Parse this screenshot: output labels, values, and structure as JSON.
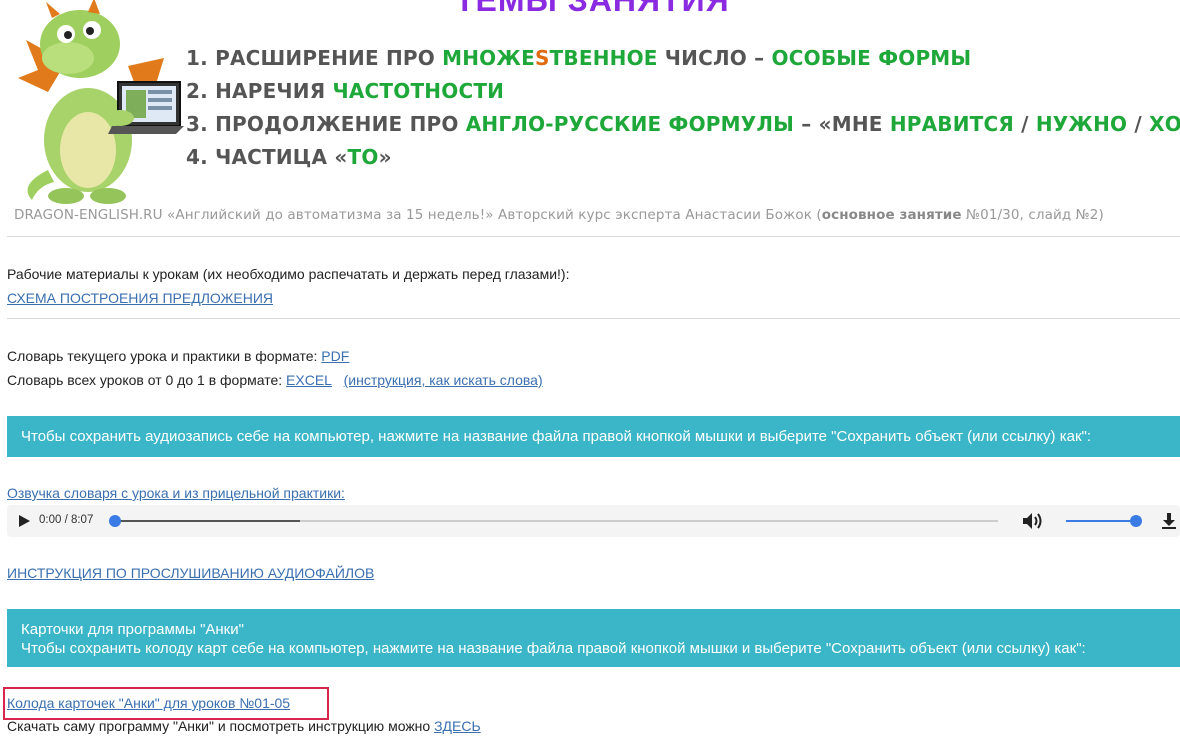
{
  "banner": {
    "title": "ТЕМЫ ЗАНЯТИЯ",
    "topics": [
      {
        "num": "1.",
        "a": "РАСШИРЕНИЕ ПРО ",
        "b": "МНОЖЕ",
        "c": "S",
        "d": "ТВЕННОЕ",
        "e": " ЧИСЛО – ",
        "f": "ОСОБЫЕ ФОРМЫ"
      },
      {
        "num": "2.",
        "a": "НАРЕЧИЯ ",
        "b": "ЧАСТОТНОСТИ"
      },
      {
        "num": "3.",
        "a": "ПРОДОЛЖЕНИЕ ПРО ",
        "b": "АНГЛО-РУССКИЕ ФОРМУЛЫ",
        "c": " – «МНЕ ",
        "d": "НРАВИТСЯ",
        "e": " / ",
        "f": "НУЖНО",
        "g": " / ",
        "h": "ХОЧЕТСЯ",
        "i": "»"
      },
      {
        "num": "4.",
        "a": "ЧАСТИЦА «",
        "b": "ТО",
        "c": "»"
      }
    ],
    "footer": {
      "prefix": "DRAGON-ENGLISH.RU «Английский до автоматизма за 15 недель!» Авторский курс эксперта Анастасии Божок (",
      "bold": "основное занятие",
      "suffix": " №01/30, слайд №2)"
    }
  },
  "materials": {
    "intro": "Рабочие материалы к урокам (их необходимо распечатать и держать перед глазами!):",
    "scheme_link": "СХЕМА ПОСТРОЕНИЯ ПРЕДЛОЖЕНИЯ"
  },
  "dictionary": {
    "current_text": "Словарь текущего урока и практики в формате: ",
    "pdf_link": "PDF",
    "all_text": "Словарь всех уроков от 0 до 1 в формате: ",
    "excel_link": "EXCEL",
    "instruction_link": "(инструкция, как искать слова)"
  },
  "audio_notice": "Чтобы сохранить аудиозапись себе на компьютер, нажмите на название файла правой кнопкой мышки и выберите \"Сохранить объект (или ссылку) как\":",
  "audio": {
    "link": "Озвучка словаря с урока и из прицельной практики:",
    "time": "0:00 / 8:07",
    "buffered_fraction": 0.21,
    "progress_fraction": 0.0,
    "volume_fraction": 1.0
  },
  "audio_instruction_link": "ИНСТРУКЦИЯ ПО ПРОСЛУШИВАНИЮ АУДИОФАЙЛОВ",
  "anki_notice": {
    "line1": "Карточки для программы \"Анки\"",
    "line2": "Чтобы сохранить колоду карт себе на компьютер, нажмите на название файла правой кнопкой мышки и выберите \"Сохранить объект (или ссылку) как\":"
  },
  "anki": {
    "deck_link": "Колода карточек \"Анки\" для уроков №01-05",
    "download_text": "Скачать саму программу \"Анки\" и посмотреть инструкцию можно ",
    "here_link": "ЗДЕСЬ"
  },
  "colors": {
    "accent_green": "#1fa83a",
    "accent_orange": "#e06a10",
    "title_purple": "#8a2be2",
    "teal_bar": "#3bb6c8",
    "link": "#3a6fb0",
    "highlight": "#d9264f",
    "player_blue": "#3b7be6"
  },
  "icons": [
    "dragon-mascot",
    "play-icon",
    "volume-icon",
    "download-icon"
  ]
}
